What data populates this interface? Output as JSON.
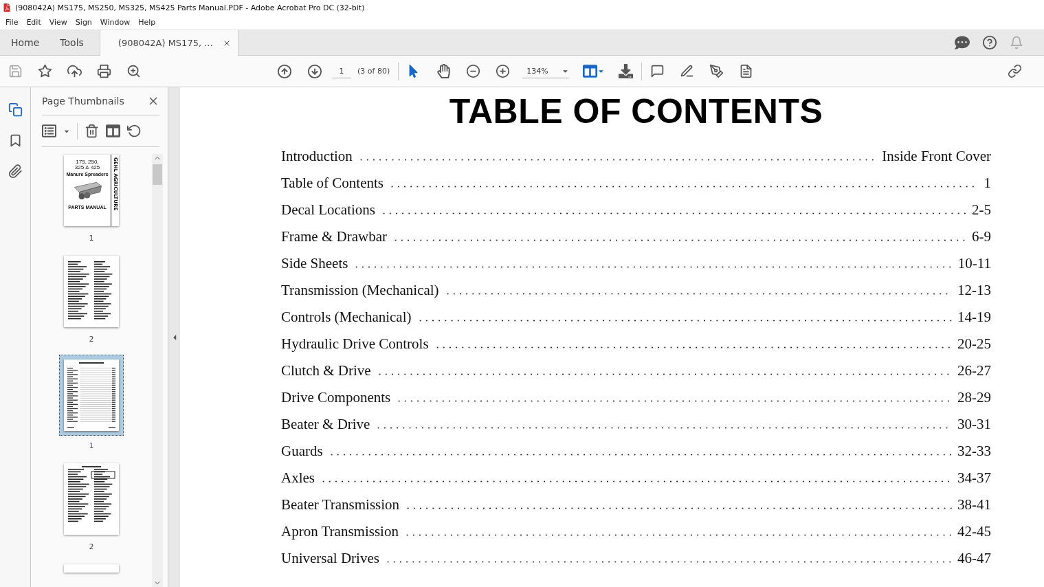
{
  "window": {
    "title": "(908042A) MS175, MS250, MS325, MS425 Parts Manual.PDF - Adobe Acrobat Pro DC (32-bit)"
  },
  "menu": [
    "File",
    "Edit",
    "View",
    "Sign",
    "Window",
    "Help"
  ],
  "tabs": [
    {
      "label": "Home",
      "selected": false,
      "kind": "nav"
    },
    {
      "label": "Tools",
      "selected": false,
      "kind": "nav"
    },
    {
      "label": "(908042A) MS175, ...",
      "selected": true,
      "kind": "doc"
    }
  ],
  "toolbar": {
    "page": "1",
    "page_count": "(3 of 80)",
    "zoom": "134%"
  },
  "sidebar": {
    "title": "Page Thumbnails",
    "cover": {
      "line_1": "175, 250,",
      "line_2": "325 & 425",
      "subtitle": "Manure Spreaders",
      "footer": "PARTS MANUAL",
      "brand": "GEHL AGRICULTURE"
    },
    "thumbnails": [
      {
        "label": "1",
        "selected": false,
        "kind": "cover"
      },
      {
        "label": "2",
        "selected": false,
        "kind": "text"
      },
      {
        "label": "1",
        "selected": true,
        "kind": "toc"
      },
      {
        "label": "2",
        "selected": false,
        "kind": "decal"
      },
      {
        "selected": false,
        "kind": "partial"
      }
    ]
  },
  "document": {
    "title": "TABLE OF CONTENTS",
    "entries": [
      {
        "title": "Introduction",
        "page": "Inside Front Cover"
      },
      {
        "title": "Table of Contents",
        "page": "1"
      },
      {
        "title": "Decal Locations",
        "page": "2-5"
      },
      {
        "title": "Frame & Drawbar",
        "page": "6-9"
      },
      {
        "title": "Side Sheets",
        "page": "10-11"
      },
      {
        "title": "Transmission (Mechanical)",
        "page": "12-13"
      },
      {
        "title": "Controls (Mechanical)",
        "page": "14-19"
      },
      {
        "title": "Hydraulic Drive Controls",
        "page": "20-25"
      },
      {
        "title": "Clutch & Drive",
        "page": "26-27"
      },
      {
        "title": "Drive Components",
        "page": "28-29"
      },
      {
        "title": "Beater & Drive",
        "page": "30-31"
      },
      {
        "title": "Guards",
        "page": "32-33"
      },
      {
        "title": "Axles",
        "page": "34-37"
      },
      {
        "title": "Beater Transmission",
        "page": "38-41"
      },
      {
        "title": "Apron Transmission",
        "page": "42-45"
      },
      {
        "title": "Universal Drives",
        "page": "46-47"
      }
    ]
  }
}
